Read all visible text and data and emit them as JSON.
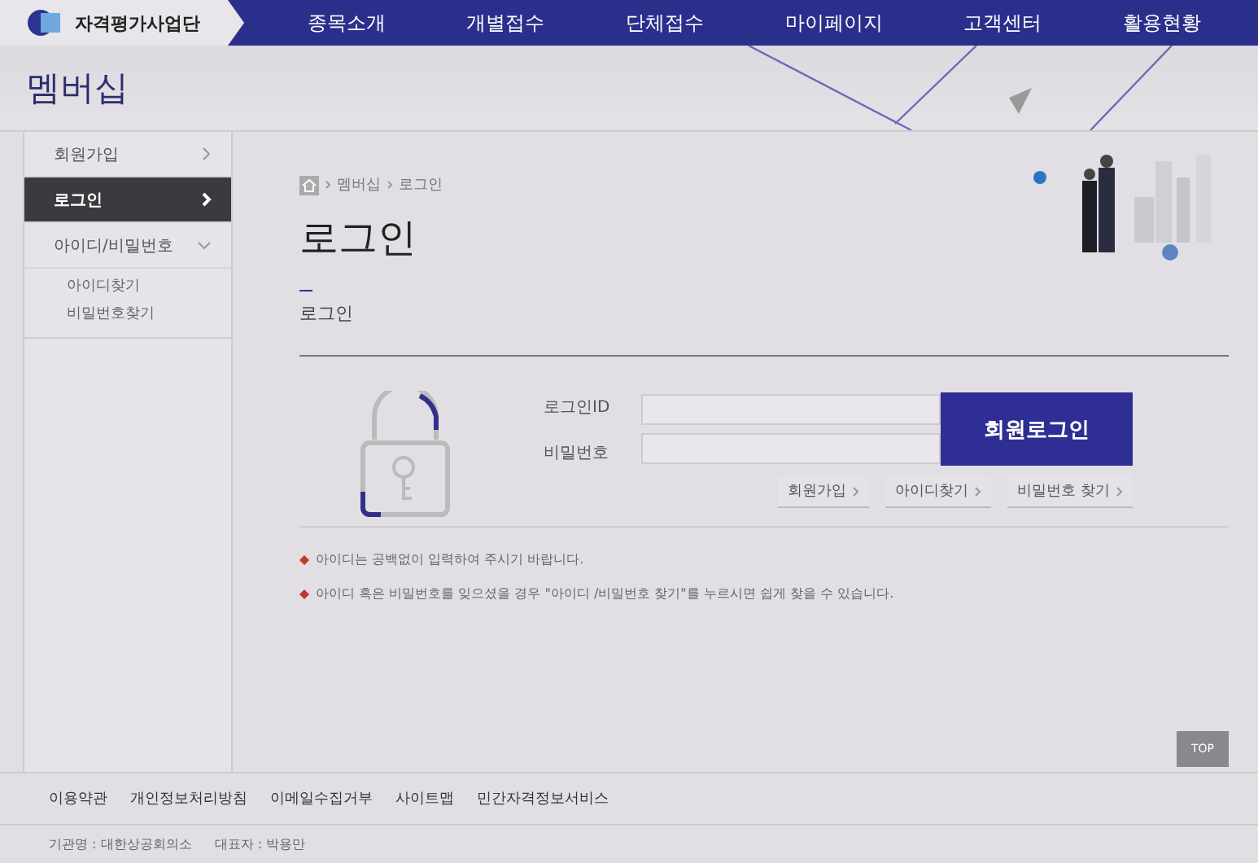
{
  "header": {
    "logo_text": "자격평가사업단",
    "nav": [
      "종목소개",
      "개별접수",
      "단체접수",
      "마이페이지",
      "고객센터",
      "활용현황"
    ]
  },
  "banner": {
    "title": "멤버십"
  },
  "sidebar": {
    "items": [
      {
        "label": "회원가입",
        "selected": false
      },
      {
        "label": "로그인",
        "selected": true
      },
      {
        "label": "아이디/비밀번호",
        "selected": false,
        "expanded": true,
        "children": [
          {
            "label": "아이디찾기"
          },
          {
            "label": "비밀번호찾기"
          }
        ]
      }
    ]
  },
  "breadcrumb": [
    "멤버십",
    "로그인"
  ],
  "page_title": "로그인",
  "section_title": "로그인",
  "form": {
    "id_label": "로그인ID",
    "password_label": "비밀번호",
    "submit": "회원로그인",
    "links": [
      "회원가입",
      "아이디찾기",
      "비밀번호 찾기"
    ]
  },
  "notes": [
    "아이디는 공백없이 입력하여 주시기 바랍니다.",
    "아이디 혹은 비밀번호를 잊으셨을 경우 \"아이디 /비밀번호 찾기\"를 누르시면 쉽게 찾을 수 있습니다."
  ],
  "top_button": "TOP",
  "footer": {
    "links": [
      "이용약관",
      "개인정보처리방침",
      "이메일수집거부",
      "사이트맵",
      "민간자격정보서비스"
    ],
    "info": [
      "기관명 : 대한상공회의소",
      "대표자 : 박용만"
    ]
  }
}
